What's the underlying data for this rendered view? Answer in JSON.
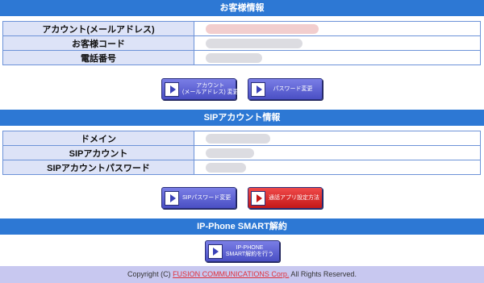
{
  "customer_info": {
    "header": "お客様情報",
    "rows": [
      {
        "label": "アカウント(メールアドレス)"
      },
      {
        "label": "お客様コード"
      },
      {
        "label": "電話番号"
      }
    ],
    "buttons": [
      {
        "line1": "アカウント",
        "line2": "(メールアドレス) 変更",
        "color": "#5a5ed8"
      },
      {
        "line1": "パスワード変更",
        "line2": "",
        "color": "#5a5ed8"
      }
    ]
  },
  "sip_info": {
    "header": "SIPアカウント情報",
    "rows": [
      {
        "label": "ドメイン"
      },
      {
        "label": "SIPアカウント"
      },
      {
        "label": "SIPアカウントパスワード"
      }
    ],
    "buttons": [
      {
        "line1": "SIPパスワード変更",
        "line2": "",
        "color": "#5a5ed8"
      },
      {
        "line1": "通話アプリ設定方法",
        "line2": "",
        "color": "#d82020"
      }
    ]
  },
  "smart_cancel": {
    "header": "IP-Phone SMART解約",
    "button": {
      "line1": "IP-PHONE",
      "line2": "SMART解約を行う",
      "color": "#5a5ed8"
    }
  },
  "footer": {
    "prefix": "Copyright (C) ",
    "company": "FUSION COMMUNICATIONS Corp.",
    "suffix": " All Rights Reserved."
  },
  "colors": {
    "header_bg": "#2d78d4",
    "label_bg": "#dde3f7",
    "footer_bg": "#c8c8f0",
    "link": "#e0303a"
  }
}
